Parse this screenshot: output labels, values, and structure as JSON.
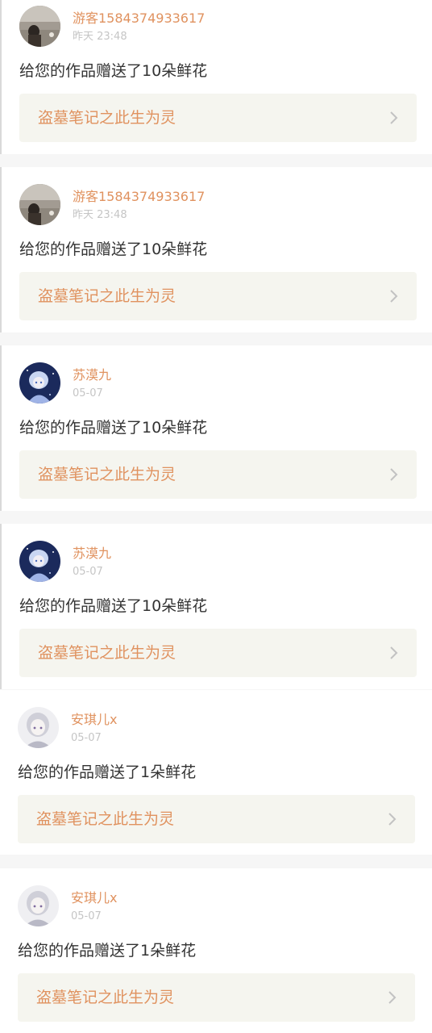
{
  "notifications": [
    {
      "user": "游客1584374933617",
      "time": "昨天 23:48",
      "message": "给您的作品赠送了10朵鲜花",
      "work_title": "盗墓笔记之此生为灵",
      "avatar": "photo-avatar"
    },
    {
      "user": "游客1584374933617",
      "time": "昨天 23:48",
      "message": "给您的作品赠送了10朵鲜花",
      "work_title": "盗墓笔记之此生为灵",
      "avatar": "photo-avatar"
    },
    {
      "user": "苏漠九",
      "time": "05-07",
      "message": "给您的作品赠送了10朵鲜花",
      "work_title": "盗墓笔记之此生为灵",
      "avatar": "anime-night-avatar"
    },
    {
      "user": "苏漠九",
      "time": "05-07",
      "message": "给您的作品赠送了10朵鲜花",
      "work_title": "盗墓笔记之此生为灵",
      "avatar": "anime-night-avatar"
    },
    {
      "user": "安琪儿x",
      "time": "05-07",
      "message": "给您的作品赠送了1朵鲜花",
      "work_title": "盗墓笔记之此生为灵",
      "avatar": "anime-girl-avatar"
    },
    {
      "user": "安琪儿x",
      "time": "05-07",
      "message": "给您的作品赠送了1朵鲜花",
      "work_title": "盗墓笔记之此生为灵",
      "avatar": "anime-girl-avatar"
    }
  ],
  "colors": {
    "accent": "#e0925f",
    "time_text": "#c5c5c5",
    "body_text": "#333333",
    "link_background": "#f5f5ef",
    "page_background": "#f6f6f6",
    "card_background": "#ffffff"
  },
  "icons": {
    "chevron": "chevron-right-icon"
  }
}
